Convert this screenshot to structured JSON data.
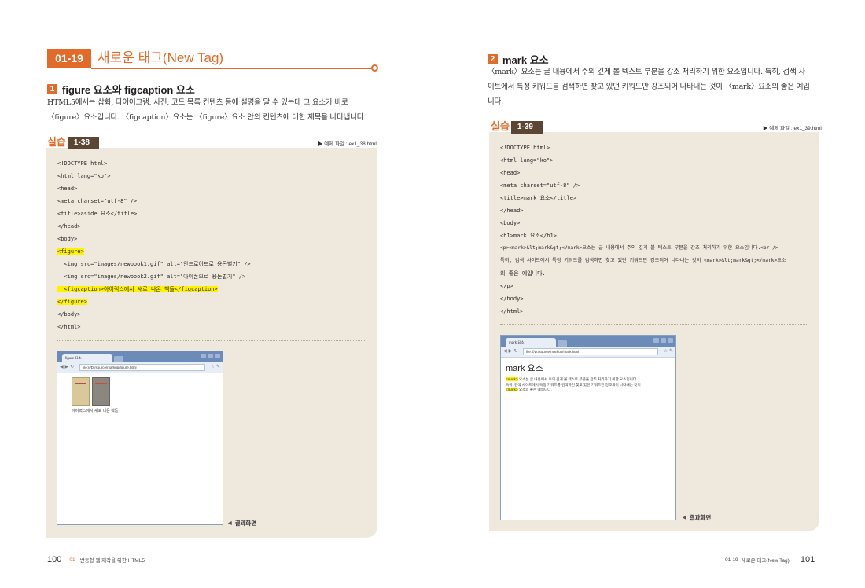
{
  "left": {
    "section": {
      "number": "01-19",
      "title": "새로운 태그(New Tag)"
    },
    "sub1": {
      "num": "1",
      "title": "figure 요소와 figcaption 요소"
    },
    "para1": [
      "HTML5에서는 삽화, 다이어그램, 사진, 코드 목록 컨텐츠 등에 설명을 달 수 있는데 그 요소가 바로",
      "〈figure〉요소입니다. 〈figcaption〉요소는 〈figure〉요소 안의 컨텐츠에 대한 제목을 나타냅니다."
    ],
    "practice": {
      "word": "실습",
      "num": "1-38",
      "file": "▶ 예제 파일 : ex1_38.html"
    },
    "code": [
      "<!DOCTYPE html>",
      "<html lang=\"ko\">",
      "<head>",
      "<meta charset=\"utf-8\" />",
      "<title>aside 요소</title>",
      "</head>",
      "<body>",
      "<figure>",
      "  <img src=\"images/newbook1.gif\" alt=\"안드로이드로 용돈벌기\" />",
      "  <img src=\"images/newbook2.gif\" alt=\"아이폰으로 용돈벌기\" />",
      "  <figcaption>아이럭스에서 새로 나온 책들</figcaption>",
      "</figure>",
      "</body>",
      "</html>"
    ],
    "browser": {
      "tab": "figure 요소",
      "url": "file:///D:/source/markup/figure.html",
      "caption": "아이럭스에서 새로 나온 책들"
    },
    "result": "결과화면",
    "footer": {
      "page": "100",
      "chapter": "01",
      "title": "반응형 웹 제작을 위한 HTML5"
    }
  },
  "right": {
    "sub2": {
      "num": "2",
      "title": "mark 요소"
    },
    "para2": [
      "〈mark〉요소는 글 내용에서 주의 깊게 볼 텍스트 부분을 강조 처리하기 위한 요소입니다. 특히, 검색 사",
      "이트에서 특정 키워드를 검색하면 찾고 있던 키워드만 강조되어 나타내는 것이 〈mark〉요소의 좋은 예입",
      "니다."
    ],
    "practice": {
      "word": "실습",
      "num": "1-39",
      "file": "▶ 예제 파일 : ex1_39.html"
    },
    "code": [
      "<!DOCTYPE html>",
      "<html lang=\"ko\">",
      "<head>",
      "<meta charset=\"utf-8\" />",
      "<title>mark 요소</title>",
      "</head>",
      "<body>",
      "<h1>mark 요소</h1>",
      "<p><mark>&lt;mark&gt;</mark>요소는 글 내용에서 주의 깊게 볼 텍스트 부분을 강조 처리하기 위한 요소입니다.<br />",
      "특히, 검색 사이트에서 특정 키워드를 검색하면 찾고 있던 키워드만 강조되어 나타내는 것이 <mark>&lt;mark&gt;</mark>요소",
      "의 좋은 예입니다.",
      "</p>",
      "</body>",
      "</html>"
    ],
    "browser": {
      "tab": "mark 요소",
      "url": "file:///D:/source/markup/mark.html",
      "h1": "mark 요소",
      "p1_mark": "<mark>",
      "p1_rest": " 요소는 글 내용에서 주의 깊게 볼 텍스트 부분을 강조 처리하기 위한 요소입니다.",
      "p2": "특히, 검색 사이트에서 특정 키워드를 검색하면 찾고 있던 키워드만 강조되어 나타내는 것이",
      "p3_mark": "<mark>",
      "p3_rest": " 요소의 좋은 예입니다."
    },
    "result": "결과화면",
    "footer": {
      "section": "01-19",
      "title": "새로운 태그(New Tag)",
      "page": "101"
    }
  }
}
